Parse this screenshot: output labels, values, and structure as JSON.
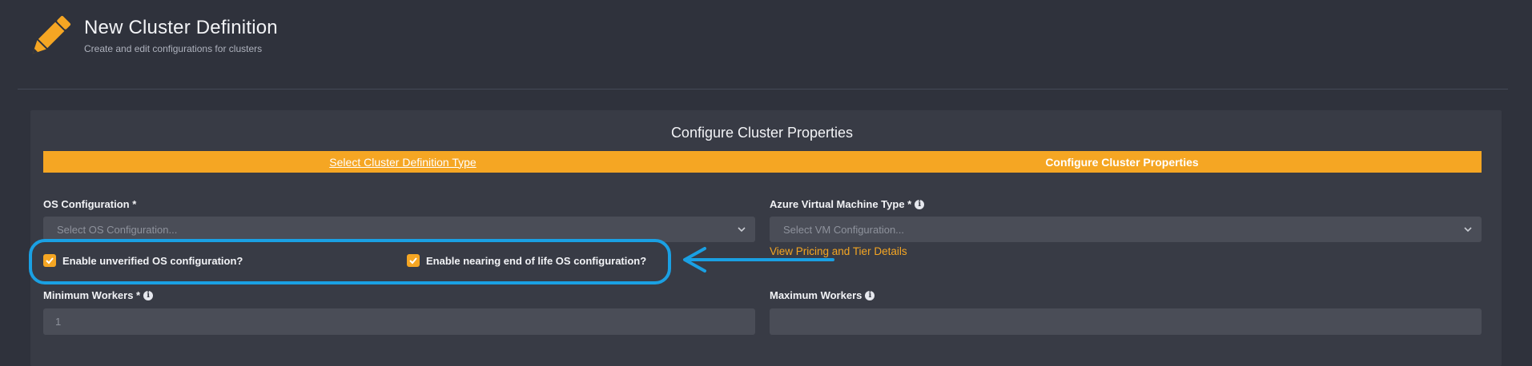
{
  "header": {
    "title": "New Cluster Definition",
    "subtitle": "Create and edit configurations for clusters",
    "icon": "pencil-icon"
  },
  "panel": {
    "title": "Configure Cluster Properties",
    "steps": [
      {
        "label": "Select Cluster Definition Type",
        "state": "completed"
      },
      {
        "label": "Configure Cluster Properties",
        "state": "active"
      }
    ]
  },
  "form": {
    "os_configuration": {
      "label": "OS Configuration *",
      "placeholder": "Select OS Configuration..."
    },
    "vm_type": {
      "label": "Azure Virtual Machine Type *",
      "placeholder": "Select VM Configuration..."
    },
    "pricing_link": "View Pricing and Tier Details",
    "unverified_os": {
      "label": "Enable unverified OS configuration?",
      "checked": true
    },
    "end_of_life_os": {
      "label": "Enable nearing end of life OS configuration?",
      "checked": true
    },
    "min_workers": {
      "label": "Minimum Workers *",
      "value": "1"
    },
    "max_workers": {
      "label": "Maximum Workers",
      "value": ""
    }
  },
  "colors": {
    "background": "#2f323c",
    "panel": "#383b45",
    "accent": "#f5a623",
    "callout": "#1aa0e3",
    "field": "#4a4d57"
  }
}
